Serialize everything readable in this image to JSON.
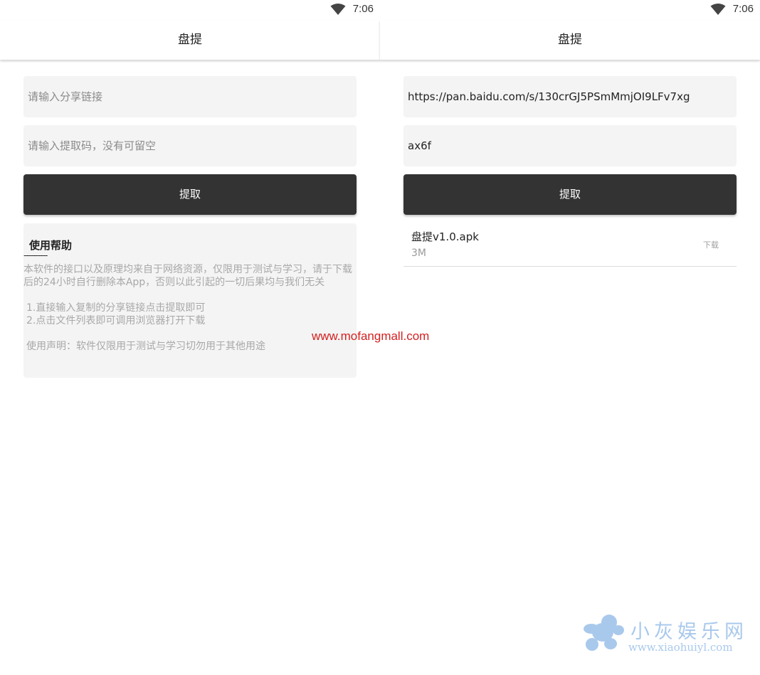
{
  "status_bar": {
    "time": "7:06",
    "wifi_icon": "wifi-icon"
  },
  "app": {
    "title": "盘提"
  },
  "left_screen": {
    "link_input": {
      "value": "",
      "placeholder": "请输入分享链接"
    },
    "code_input": {
      "value": "",
      "placeholder": "请输入提取码，没有可留空"
    },
    "extract_button": "提取",
    "help": {
      "title": "使用帮助",
      "divider": "----------",
      "paragraphs": [
        " 本软件的接口以及原理均来自于网络资源，仅限用于测试与学习，请于下载后的24小时自行删除本App，否则以此引起的一切后果均与我们无关",
        " 1.直接输入复制的分享链接点击提取即可",
        " 2.点击文件列表即可调用浏览器打开下载",
        " 使用声明：软件仅限用于测试与学习切勿用于其他用途"
      ]
    }
  },
  "right_screen": {
    "link_input": {
      "value": "https://pan.baidu.com/s/130crGJ5PSmMmjOI9LFv7xg"
    },
    "code_input": {
      "value": "ax6f"
    },
    "extract_button": "提取",
    "files": [
      {
        "name": "盘提v1.0.apk",
        "size": "3M",
        "action": "下载"
      }
    ]
  },
  "watermarks": {
    "url": "www.mofangmall.com",
    "brand": "小灰娱乐网",
    "domain": "www.xiaohuiyl.com",
    "colors": {
      "url": "#d42020",
      "brand": "#a9c9ec"
    }
  }
}
